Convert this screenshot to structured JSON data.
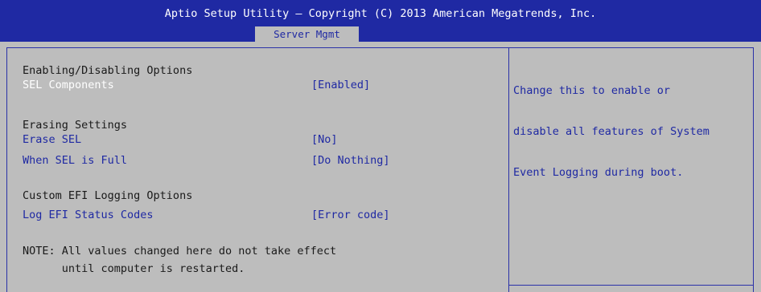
{
  "header": {
    "title": "Aptio Setup Utility – Copyright (C) 2013 American Megatrends, Inc.",
    "active_tab": "Server Mgmt"
  },
  "main": {
    "section1_heading": "Enabling/Disabling Options",
    "sel_components": {
      "label": "SEL Components",
      "value": "[Enabled]"
    },
    "section2_heading": "Erasing Settings",
    "erase_sel": {
      "label": "Erase SEL",
      "value": "[No]"
    },
    "when_sel_full": {
      "label": "When SEL is Full",
      "value": "[Do Nothing]"
    },
    "section3_heading": "Custom EFI Logging Options",
    "log_efi_status": {
      "label": "Log EFI Status Codes",
      "value": "[Error code]"
    },
    "note_line1": "NOTE: All values changed here do not take effect",
    "note_line2": "      until computer is restarted."
  },
  "help": {
    "line1": "Change this to enable or",
    "line2": "disable all features of System",
    "line3": "Event Logging during boot."
  },
  "colors": {
    "header_bg": "#1f29a3",
    "body_bg": "#bdbdbd",
    "item_text": "#1f29a3",
    "selected_text": "#ffffff"
  }
}
